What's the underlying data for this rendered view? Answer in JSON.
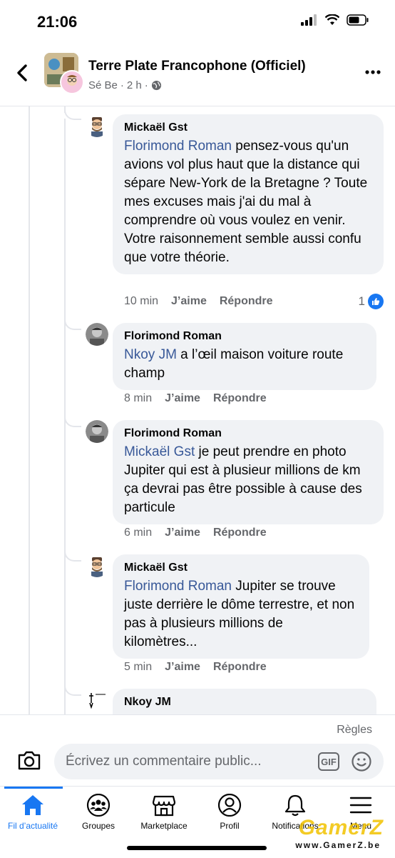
{
  "status_bar": {
    "time": "21:06"
  },
  "header": {
    "title": "Terre Plate Francophone (Officiel)",
    "author": "Sé Be",
    "time_ago": "2 h",
    "separator": "·"
  },
  "comments": [
    {
      "author": "Mickaël Gst",
      "mention": "Florimond Roman",
      "text": " pensez-vous qu'un avions vol plus haut que la distance qui sépare New-York de la Bretagne ? Toute mes excuses mais j'ai du mal à comprendre où vous voulez en venir.\nVotre raisonnement semble aussi confu que votre théorie.",
      "time": "10 min",
      "like_label": "J’aime",
      "reply_label": "Répondre",
      "reactions": "1"
    },
    {
      "author": "Florimond Roman",
      "mention": "Nkoy JM",
      "text": " a l’œil maison voiture route champ",
      "time": "8 min",
      "like_label": "J’aime",
      "reply_label": "Répondre"
    },
    {
      "author": "Florimond Roman",
      "mention": "Mickaël Gst",
      "text": " je peut prendre en photo Jupiter qui est à plusieur millions de km ça devrai pas être possible à cause des particule",
      "time": "6 min",
      "like_label": "J’aime",
      "reply_label": "Répondre"
    },
    {
      "author": "Mickaël Gst",
      "mention": "Florimond Roman",
      "text": " Jupiter se trouve juste derrière le dôme terrestre, et non pas à plusieurs millions de kilomètres...",
      "time": "5 min",
      "like_label": "J’aime",
      "reply_label": "Répondre"
    },
    {
      "author": "Nkoy JM"
    }
  ],
  "composer": {
    "rules_label": "Règles",
    "placeholder": "Écrivez un commentaire public...",
    "gif_label": "GIF"
  },
  "tabs": [
    {
      "label": "Fil d’actualité",
      "icon": "home-icon"
    },
    {
      "label": "Groupes",
      "icon": "groups-icon"
    },
    {
      "label": "Marketplace",
      "icon": "marketplace-icon"
    },
    {
      "label": "Profil",
      "icon": "profile-icon"
    },
    {
      "label": "Notifications",
      "icon": "bell-icon"
    },
    {
      "label": "Menu",
      "icon": "menu-icon"
    }
  ],
  "watermark": {
    "logo": "GamerZ",
    "url": "www.GamerZ.be"
  },
  "colors": {
    "accent": "#1877f2",
    "mention": "#385898",
    "bubble": "#f0f2f5",
    "muted": "#65676b"
  }
}
